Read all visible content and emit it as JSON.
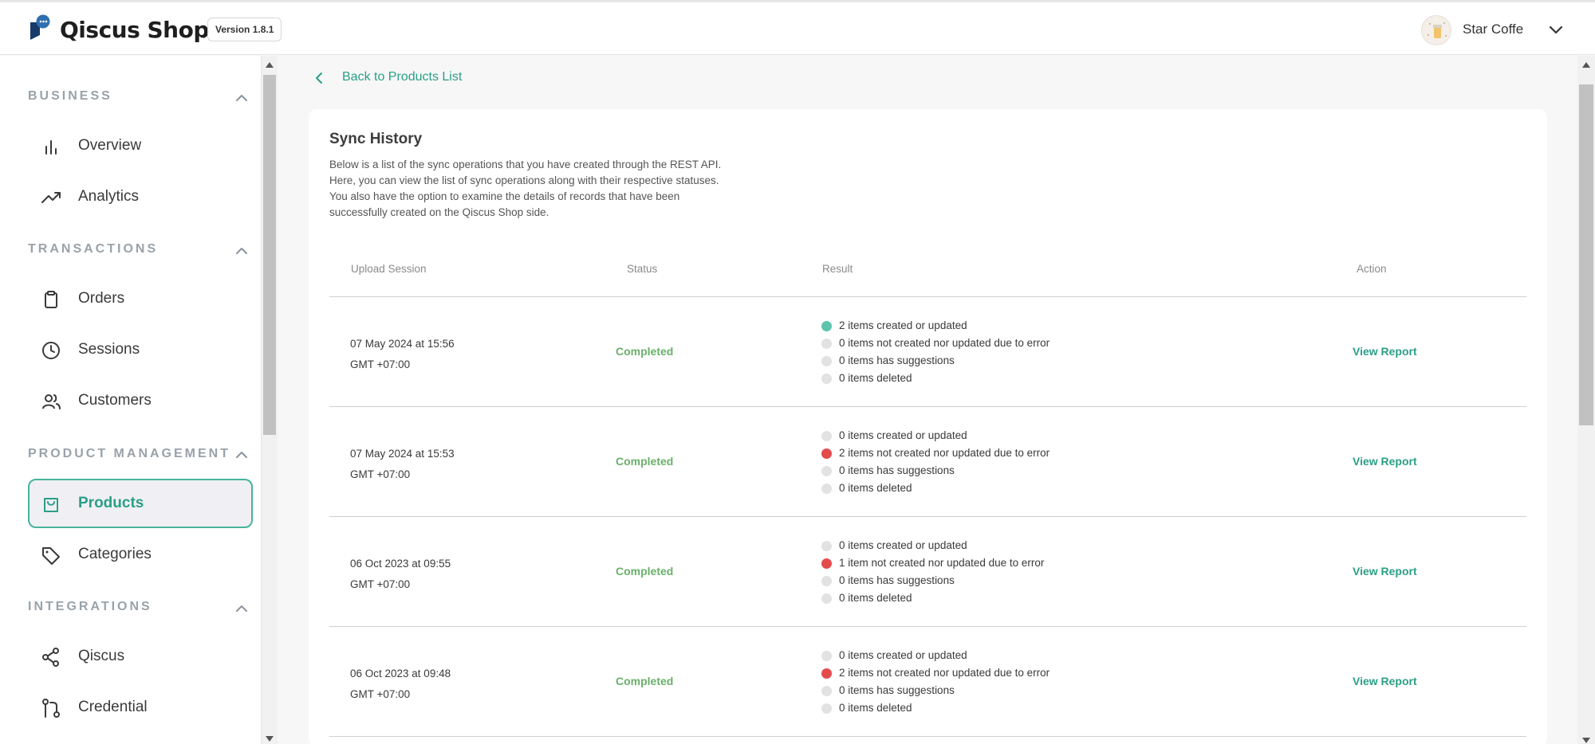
{
  "header": {
    "brand": "Qiscus Shop",
    "version": "Version 1.8.1",
    "store_name": "Star Coffe"
  },
  "sidebar": {
    "sections": [
      {
        "title": "BUSINESS",
        "items": [
          {
            "label": "Overview",
            "icon": "bar-chart-icon"
          },
          {
            "label": "Analytics",
            "icon": "trending-up-icon"
          }
        ]
      },
      {
        "title": "TRANSACTIONS",
        "items": [
          {
            "label": "Orders",
            "icon": "clipboard-icon"
          },
          {
            "label": "Sessions",
            "icon": "clock-icon"
          },
          {
            "label": "Customers",
            "icon": "users-icon"
          }
        ]
      },
      {
        "title": "PRODUCT MANAGEMENT",
        "items": [
          {
            "label": "Products",
            "icon": "shopping-bag-icon",
            "active": true
          },
          {
            "label": "Categories",
            "icon": "tag-icon"
          }
        ]
      },
      {
        "title": "INTEGRATIONS",
        "items": [
          {
            "label": "Qiscus",
            "icon": "share-icon"
          },
          {
            "label": "Credential",
            "icon": "git-pull-request-icon"
          }
        ]
      }
    ]
  },
  "main": {
    "back_label": "Back to Products List",
    "title": "Sync History",
    "description": [
      "Below is a list of the sync operations that you have created through the REST API.",
      "Here, you can view the list of sync operations along with their respective statuses.",
      "You also have the option to examine the details of records that have been",
      "successfully created on the Qiscus Shop side."
    ],
    "columns": [
      "Upload Session",
      "Status",
      "Result",
      "Action"
    ],
    "rows": [
      {
        "date": "07 May 2024 at 15:56",
        "tz": "GMT +07:00",
        "status": "Completed",
        "results": [
          {
            "text": "2 items created or updated",
            "color": "#5cc4ab"
          },
          {
            "text": "0 items not created nor updated due to error",
            "color": "#e2e2e2"
          },
          {
            "text": "0 items has suggestions",
            "color": "#e2e2e2"
          },
          {
            "text": "0 items deleted",
            "color": "#e2e2e2"
          }
        ],
        "action": "View Report"
      },
      {
        "date": "07 May 2024 at 15:53",
        "tz": "GMT +07:00",
        "status": "Completed",
        "results": [
          {
            "text": "0 items created or updated",
            "color": "#e2e2e2"
          },
          {
            "text": "2 items not created nor updated due to error",
            "color": "#e44b4b"
          },
          {
            "text": "0 items has suggestions",
            "color": "#e2e2e2"
          },
          {
            "text": "0 items deleted",
            "color": "#e2e2e2"
          }
        ],
        "action": "View Report"
      },
      {
        "date": "06 Oct 2023 at 09:55",
        "tz": "GMT +07:00",
        "status": "Completed",
        "results": [
          {
            "text": "0 items created or updated",
            "color": "#e2e2e2"
          },
          {
            "text": "1 item not created nor updated due to error",
            "color": "#e44b4b"
          },
          {
            "text": "0 items has suggestions",
            "color": "#e2e2e2"
          },
          {
            "text": "0 items deleted",
            "color": "#e2e2e2"
          }
        ],
        "action": "View Report"
      },
      {
        "date": "06 Oct 2023 at 09:48",
        "tz": "GMT +07:00",
        "status": "Completed",
        "results": [
          {
            "text": "0 items created or updated",
            "color": "#e2e2e2"
          },
          {
            "text": "2 items not created nor updated due to error",
            "color": "#e44b4b"
          },
          {
            "text": "0 items has suggestions",
            "color": "#e2e2e2"
          },
          {
            "text": "0 items deleted",
            "color": "#e2e2e2"
          }
        ],
        "action": "View Report"
      }
    ]
  },
  "colors": {
    "accent": "#2a9f86",
    "status_completed": "#6ab06a",
    "error": "#e44b4b",
    "success": "#5cc4ab"
  }
}
